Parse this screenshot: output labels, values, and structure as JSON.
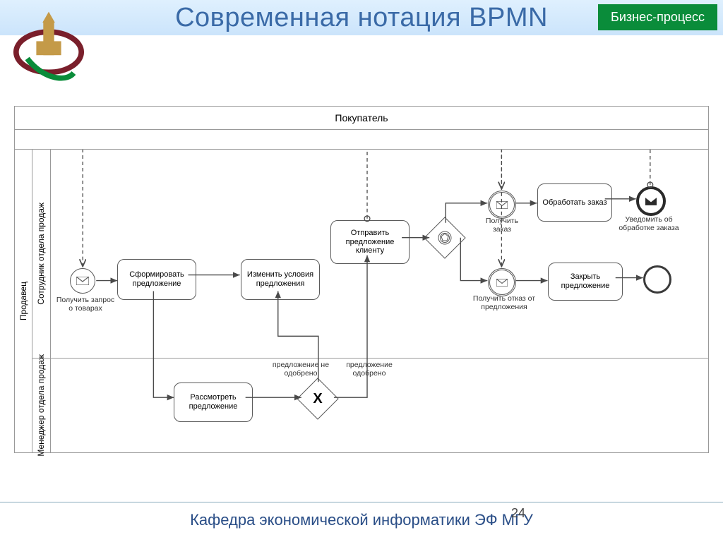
{
  "header": {
    "badge": "Бизнес-процесс",
    "title": "Современная нотация BPMN"
  },
  "footer": {
    "dept": "Кафедра экономической информатики ЭФ МГУ",
    "page": "24"
  },
  "pool": {
    "buyer": "Покупатель",
    "seller": "Продавец",
    "lane1": "Сотрудник отдела продаж",
    "lane2": "Менеджер отдела продаж"
  },
  "tasks": {
    "t_receive": "Получить запрос о товарах",
    "t_form": "Сформировать предложение",
    "t_review": "Рассмотреть предложение",
    "t_modify": "Изменить условия предложения",
    "t_send": "Отправить предложение клиенту",
    "t_getorder": "Получить заказ",
    "t_process": "Обработать заказ",
    "t_notify": "Уведомить об обработке заказа",
    "t_getreject": "Получить отказ от предложения",
    "t_close": "Закрыть предложение"
  },
  "gateways": {
    "g_approve_no": "предложение не одобрено",
    "g_approve_yes": "предложение одобрено"
  }
}
